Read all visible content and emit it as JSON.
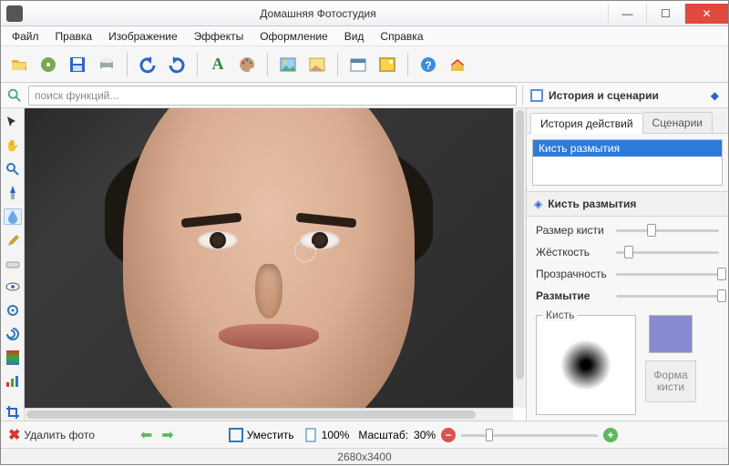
{
  "window": {
    "title": "Домашняя Фотостудия"
  },
  "menu": {
    "file": "Файл",
    "edit": "Правка",
    "image": "Изображение",
    "effects": "Эффекты",
    "decor": "Оформление",
    "view": "Вид",
    "help": "Справка"
  },
  "search": {
    "placeholder": "поиск функций..."
  },
  "rightPanel": {
    "header": "История и сценарии",
    "tabs": {
      "history": "История действий",
      "scenarios": "Сценарии"
    },
    "historyItems": [
      "Кисть размытия"
    ],
    "section": "Кисть размытия",
    "params": {
      "size": {
        "label": "Размер кисти",
        "pos": 30
      },
      "hard": {
        "label": "Жёсткость",
        "pos": 8
      },
      "opac": {
        "label": "Прозрачность",
        "pos": 98
      },
      "blur": {
        "label": "Размытие",
        "pos": 98
      }
    },
    "brushLegend": "Кисть",
    "shapeBtn": "Форма кисти",
    "swatch": "#8a8ad0"
  },
  "bottom": {
    "delete": "Удалить фото",
    "fit": "Уместить",
    "p100": "100%",
    "zoomLabel": "Масштаб:",
    "zoomVal": "30%",
    "zoomPos": 18
  },
  "status": {
    "dims": "2680x3400"
  }
}
